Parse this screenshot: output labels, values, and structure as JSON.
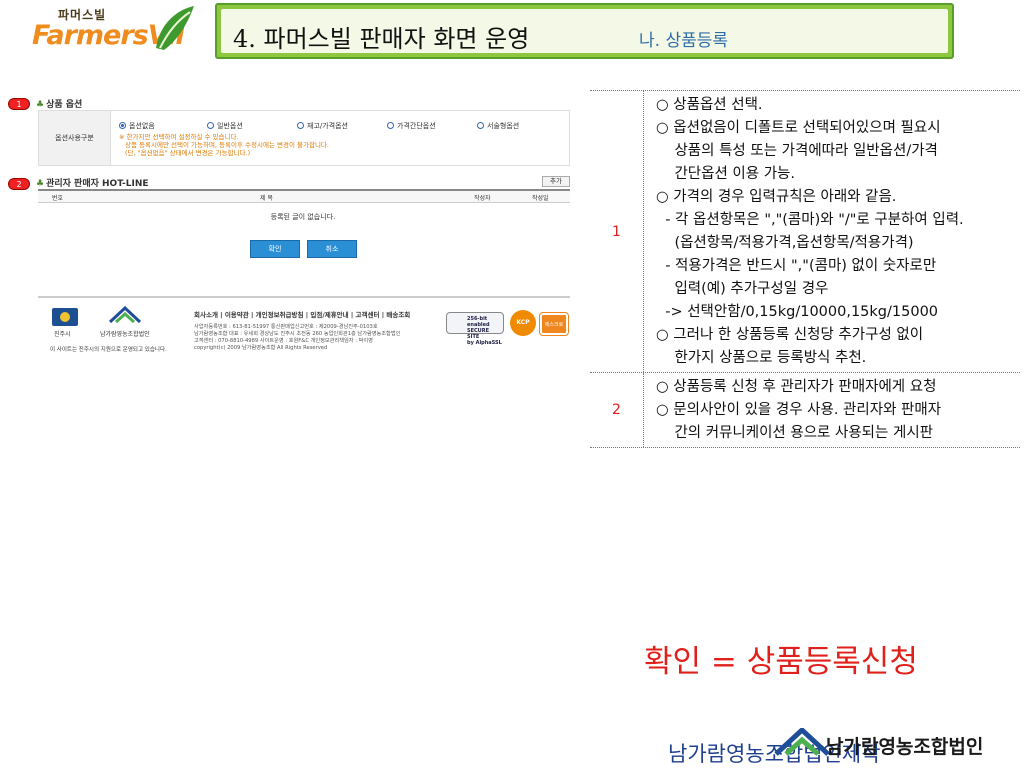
{
  "header": {
    "logo_top": "파머스빌",
    "logo_main": "FarmersVil",
    "title": "4. 파머스빌 판매자 화면 운영",
    "subtitle": "나. 상품등록"
  },
  "screenshot": {
    "marker1": "1",
    "marker2": "2",
    "option_section_title": "상품 옵션",
    "option_label": "옵션사용구분",
    "radios": [
      {
        "label": "옵션없음",
        "checked": true
      },
      {
        "label": "일반옵션",
        "checked": false
      },
      {
        "label": "재고/가격옵션",
        "checked": false
      },
      {
        "label": "가격간단옵션",
        "checked": false
      },
      {
        "label": "서술형옵션",
        "checked": false
      }
    ],
    "option_note_1": "※ 한가지만 선택하여 설정하실 수 있습니다.",
    "option_note_2": "상품 등록시에만 선택이 가능하며, 등록이후 수정시에는 변경이 불가합니다.",
    "option_note_3": "(단, \"옵션없음\" 상태에서 변경은 가능합니다.)",
    "hotline_title": "관리자 판매자 HOT-LINE",
    "add_button": "추가",
    "table_headers": {
      "no": "번호",
      "title": "제 목",
      "author": "작성자",
      "date": "작성일"
    },
    "empty_message": "등록된 글이 없습니다.",
    "confirm_button": "확인",
    "cancel_button": "취소",
    "footer_links": "회사소개 | 이용약관 | 개인정보취급방침 | 입점/제휴안내 | 고객센터 | 배송조회",
    "footer_info_1": "사업자등록번호 : 613-81-51997   통신판매업신고번호 : 제2009-경남진주-0103호",
    "footer_info_2": "남가람영농조합 대표 : 유세희   경상남도 진주시 초전동 260 농업인회관1층 남가람영농조합법인",
    "footer_info_3": "고객센터 : 070-8810-4989   사이트운영 : 호원F&C   개인정보관리책임자 : 박이영",
    "footer_info_4": "copyright(c) 2009 남가람영농조합 All Rights Reserved",
    "jinju_label": "진주시",
    "nh_label": "남가람영농조합법인",
    "footer_note": "이 사이트는 진주시의 지원으로 운영되고 있습니다.",
    "badge_secure_1": "256-bit enabled",
    "badge_secure_2": "SECURE SITE",
    "badge_secure_3": "by AlphaSSL",
    "badge_kcp": "KCP",
    "badge_escrow": "에스크로"
  },
  "explanations": [
    {
      "num": "1",
      "lines": [
        "○ 상품옵션 선택.",
        "○ 옵션없음이 디폴트로 선택되어있으며 필요시",
        "    상품의 특성 또는 가격에따라 일반옵션/가격",
        "    간단옵션 이용 가능.",
        "○ 가격의 경우 입력규칙은 아래와 같음.",
        "  - 각 옵션항목은 \",\"(콤마)와 \"/\"로 구분하여 입력.",
        "    (옵션항목/적용가격,옵션항목/적용가격)",
        "  - 적용가격은 반드시 \",\"(콤마) 없이 숫자로만",
        "    입력(예) 추가구성일 경우",
        "  -> 선택안함/0,15kg/10000,15kg/15000",
        "○ 그러나 한 상품등록 신청당 추가구성 없이",
        "    한가지 상품으로 등록방식 추천."
      ]
    },
    {
      "num": "2",
      "lines": [
        "○ 상품등록 신청 후 관리자가 판매자에게 요청",
        "○ 문의사안이 있을 경우 사용. 관리자와 판매자",
        "    간의 커뮤니케이션 용으로 사용되는 게시판"
      ]
    }
  ],
  "confirm_note": "확인 = 상품등록신청",
  "company_logo_text": "남가람영농조합법인",
  "company_footer": "남가람영농조합법인제작"
}
